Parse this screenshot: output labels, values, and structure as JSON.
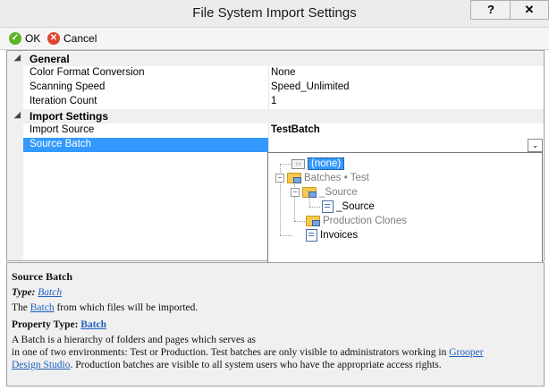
{
  "window": {
    "title": "File System Import Settings",
    "help_label": "?",
    "close_label": "✕"
  },
  "toolbar": {
    "ok_label": "OK",
    "cancel_label": "Cancel"
  },
  "grid": {
    "categories": [
      {
        "label": "General",
        "expander": "◢"
      },
      {
        "label": "Import Settings",
        "expander": "◢"
      }
    ],
    "properties": [
      {
        "name": "Color Format Conversion",
        "value": "None"
      },
      {
        "name": "Scanning Speed",
        "value": "Speed_Unlimited"
      },
      {
        "name": "Iteration Count",
        "value": "1"
      },
      {
        "name": "Import Source",
        "value": "TestBatch"
      },
      {
        "name": "Source Batch",
        "value": ""
      }
    ],
    "dropdown_arrow": "⌄"
  },
  "tree": {
    "items": [
      {
        "label": "(none)",
        "icon": "none-icon"
      },
      {
        "label": "Batches • Test",
        "icon": "folder-icon"
      },
      {
        "label": "_Source",
        "icon": "folder-icon"
      },
      {
        "label": "_Source",
        "icon": "batch-icon"
      },
      {
        "label": "Production Clones",
        "icon": "folder-icon"
      },
      {
        "label": "Invoices",
        "icon": "batch-icon"
      }
    ],
    "toggles": [
      "−",
      "−"
    ]
  },
  "help": {
    "title": "Source Batch",
    "type_label": "Type:",
    "type_link": "Batch",
    "desc_pre": "The ",
    "desc_link": "Batch",
    "desc_post": " from which files will be imported.",
    "property_type_label": "Property Type:",
    "property_type_link": "Batch",
    "para_line1": "A Batch is a hierarchy of folders and pages which serves as",
    "para_line2_pre": "in one of two environments: Test or Production.  Test batches are only visible to administrators working in ",
    "para_link": "Grooper",
    "para_line3_link": "Design Studio",
    "para_line3_post": ".  Production batches are visible to all system users who have the appropriate access rights."
  }
}
